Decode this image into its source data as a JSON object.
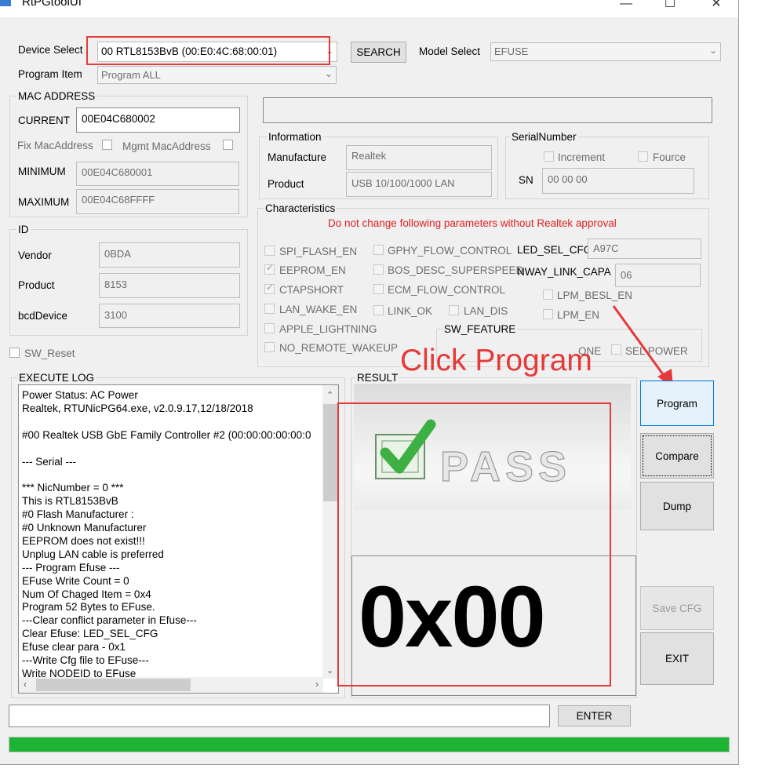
{
  "window": {
    "title": "RtPGtoolUI"
  },
  "device": {
    "label": "Device Select",
    "value": "00 RTL8153BvB (00:E0:4C:68:00:01)",
    "search_label": "SEARCH",
    "model_label": "Model Select",
    "model_value": "EFUSE",
    "program_item_label": "Program Item",
    "program_item_value": "Program ALL"
  },
  "mac": {
    "group": "MAC ADDRESS",
    "current_label": "CURRENT",
    "current_value": "00E04C680002",
    "fix_label": "Fix MacAddress",
    "mgmt_label": "Mgmt MacAddress",
    "min_label": "MINIMUM",
    "min_value": "00E04C680001",
    "max_label": "MAXIMUM",
    "max_value": "00E04C68FFFF"
  },
  "id": {
    "group": "ID",
    "vendor_label": "Vendor",
    "vendor_value": "0BDA",
    "product_label": "Product",
    "product_value": "8153",
    "bcd_label": "bcdDevice",
    "bcd_value": "3100"
  },
  "sw_reset": "SW_Reset",
  "info": {
    "group": "Information",
    "manufacture_label": "Manufacture",
    "manufacture_value": "Realtek",
    "product_label": "Product",
    "product_value": "USB 10/100/1000 LAN"
  },
  "serial": {
    "group": "SerialNumber",
    "increment": "Increment",
    "fource": "Fource",
    "sn_label": "SN",
    "sn_value": "00 00 00"
  },
  "characteristics": {
    "group": "Characteristics",
    "warning": "Do not change following parameters without Realtek approval",
    "col1": [
      "SPI_FLASH_EN",
      "EEPROM_EN",
      "CTAPSHORT",
      "LAN_WAKE_EN",
      "APPLE_LIGHTNING",
      "NO_REMOTE_WAKEUP"
    ],
    "col2": [
      "GPHY_FLOW_CONTROL",
      "BOS_DESC_SUPERSPEED",
      "ECM_FLOW_CONTROL",
      "LINK_OK",
      "LAN_DIS"
    ],
    "led_label": "LED_SEL_CFG",
    "led_value": "A97C",
    "nway_label": "NWAY_LINK_CAPA",
    "nway_value": "06",
    "lpm_besl": "LPM_BESL_EN",
    "lpm_en": "LPM_EN",
    "sw_feature": "SW_FEATURE",
    "sw_none": "ONE",
    "sw_self_power": "SEL POWER"
  },
  "log": {
    "group": "EXECUTE LOG",
    "lines": [
      "Power Status: AC Power",
      "Realtek, RTUNicPG64.exe, v2.0.9.17,12/18/2018",
      "",
      "#00 Realtek USB GbE Family Controller #2 (00:00:00:00:00:0",
      "",
      " --- Serial ---",
      "",
      "*** NicNumber = 0 ***",
      "This is RTL8153BvB",
      "#0  Flash Manufacturer :",
      " #0 Unknown Manufacturer",
      "EEPROM does not exist!!!",
      " Unplug LAN cable is preferred",
      "--- Program Efuse ---",
      "EFuse Write Count = 0",
      "Num Of Chaged Item = 0x4",
      "Program 52 Bytes to EFuse.",
      "---Clear conflict parameter in Efuse---",
      " Clear Efuse: LED_SEL_CFG",
      "Efuse clear para - 0x1",
      "---Write Cfg file to EFuse---",
      " Write NODEID to EFuse"
    ]
  },
  "result": {
    "group": "RESULT",
    "code": "0x00",
    "pass_text": "PASS"
  },
  "buttons": {
    "program": "Program",
    "compare": "Compare",
    "dump": "Dump",
    "save_cfg": "Save CFG",
    "exit": "EXIT",
    "enter": "ENTER"
  },
  "annotation": {
    "click_program": "Click Program"
  },
  "progress": {
    "value": 1.0,
    "color": "#1db435"
  },
  "colors": {
    "annotation_red": "#e5393a",
    "warning_red": "#e02020",
    "check_green": "#3cb043"
  }
}
